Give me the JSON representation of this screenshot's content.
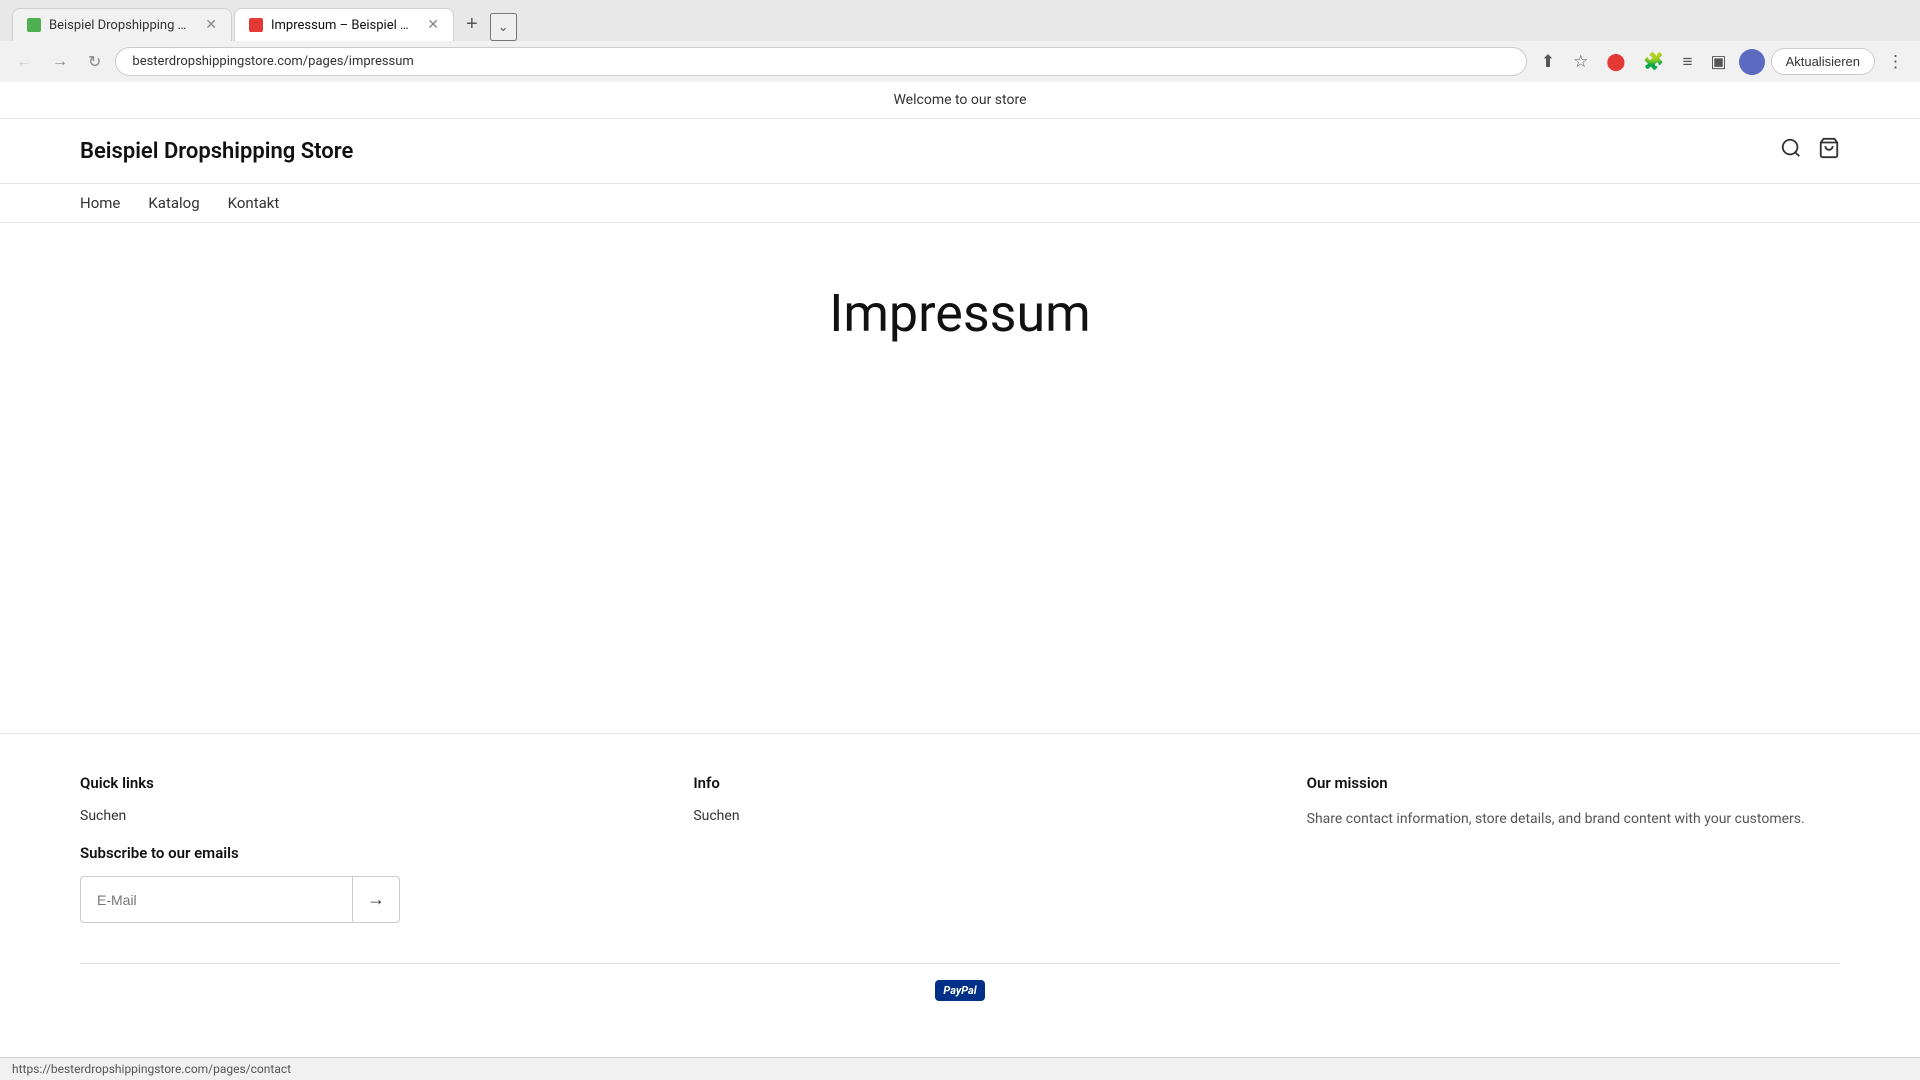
{
  "browser": {
    "tabs": [
      {
        "id": "tab1",
        "favicon_color": "#4CAF50",
        "title": "Beispiel Dropshipping Store -...",
        "active": false
      },
      {
        "id": "tab2",
        "favicon_color": "#e53935",
        "title": "Impressum – Beispiel Dropship...",
        "active": true
      }
    ],
    "url_display": "besterdropshippingstore.com/pages/impressum",
    "update_button_label": "Aktualisieren",
    "more_label": "⋮"
  },
  "store": {
    "announcement": "Welcome to our store",
    "logo": "Beispiel Dropshipping Store",
    "nav": {
      "home": "Home",
      "katalog": "Katalog",
      "kontakt": "Kontakt"
    },
    "page_title": "Impressum"
  },
  "footer": {
    "quick_links": {
      "title": "Quick links",
      "links": [
        "Suchen"
      ]
    },
    "info": {
      "title": "Info",
      "links": [
        "Suchen"
      ]
    },
    "mission": {
      "title": "Our mission",
      "text": "Share contact information, store details, and brand content with your customers."
    },
    "subscribe": {
      "title": "Subscribe to our emails",
      "email_placeholder": "E-Mail"
    }
  },
  "status_bar": {
    "url": "https://besterdropshippingstore.com/pages/contact"
  }
}
